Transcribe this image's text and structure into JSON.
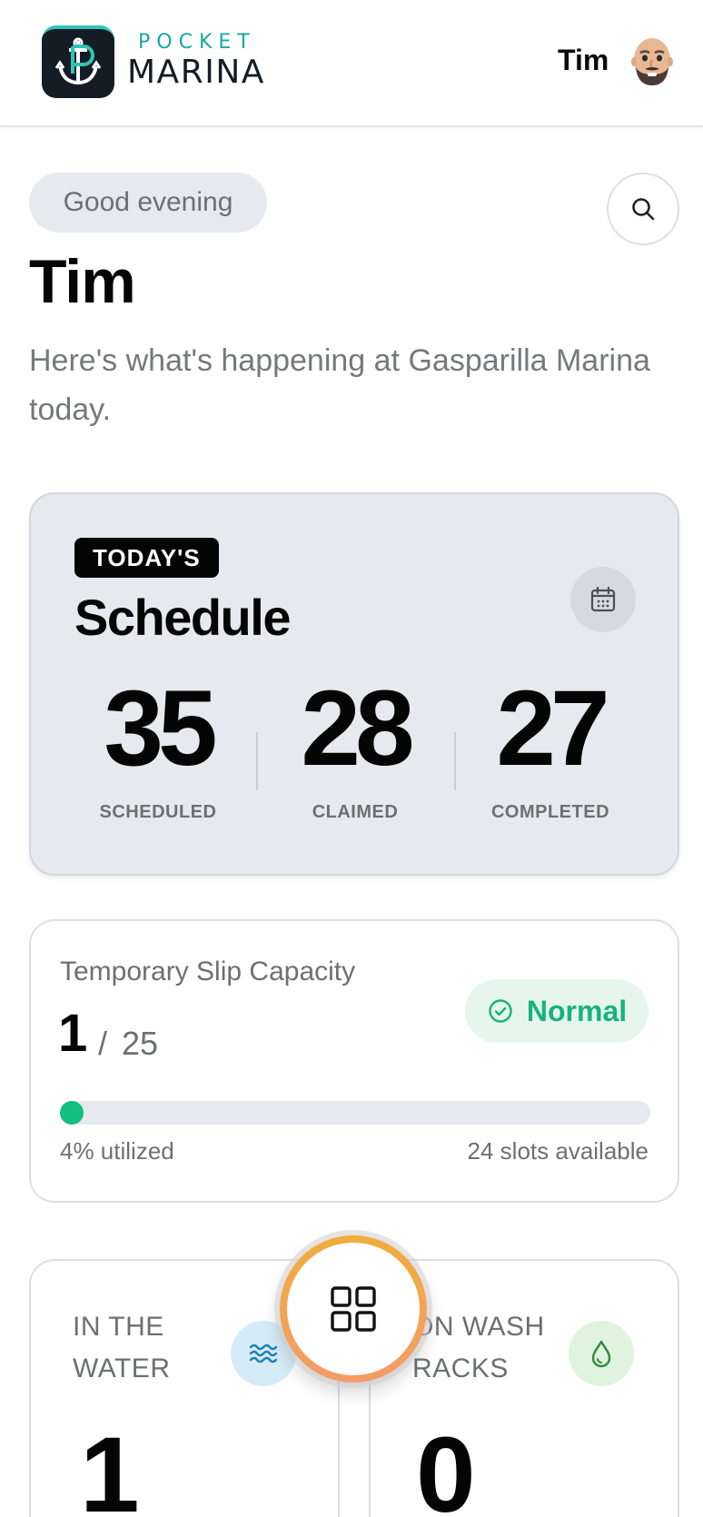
{
  "header": {
    "brand_small": "POCKET",
    "brand_big": "MARINA",
    "user_name": "Tim",
    "logo_icon": "anchor-p-logo-icon",
    "avatar_icon": "memoji-avatar"
  },
  "greeting": {
    "pill": "Good evening",
    "name": "Tim",
    "subtitle": "Here's what's happening at Gasparilla Marina today.",
    "search_icon": "search-icon"
  },
  "schedule": {
    "badge": "TODAY'S",
    "title": "Schedule",
    "calendar_icon": "calendar-icon",
    "stats": [
      {
        "value": "35",
        "label": "SCHEDULED"
      },
      {
        "value": "28",
        "label": "CLAIMED"
      },
      {
        "value": "27",
        "label": "COMPLETED"
      }
    ]
  },
  "capacity": {
    "title": "Temporary Slip Capacity",
    "current": "1",
    "separator": "/",
    "total": "25",
    "status": "Normal",
    "status_icon": "check-circle-icon",
    "utilized_fraction": 0.04,
    "utilized_text": "4% utilized",
    "available_text": "24 slots available",
    "colors": {
      "fill": "#12bf7e",
      "status": "#18b27e",
      "status_bg": "#e6f6ef"
    }
  },
  "tiles": [
    {
      "label_line1": "IN THE",
      "label_line2": "WATER",
      "value": "1",
      "icon": "waves-icon",
      "icon_bg": "#d5ebf8"
    },
    {
      "label_line1": "ON WASH",
      "label_line2": "RACKS",
      "value": "0",
      "icon": "droplet-icon",
      "icon_bg": "#dff3df"
    }
  ],
  "fab": {
    "icon": "grid-icon",
    "accent": "#f1ad3c"
  }
}
